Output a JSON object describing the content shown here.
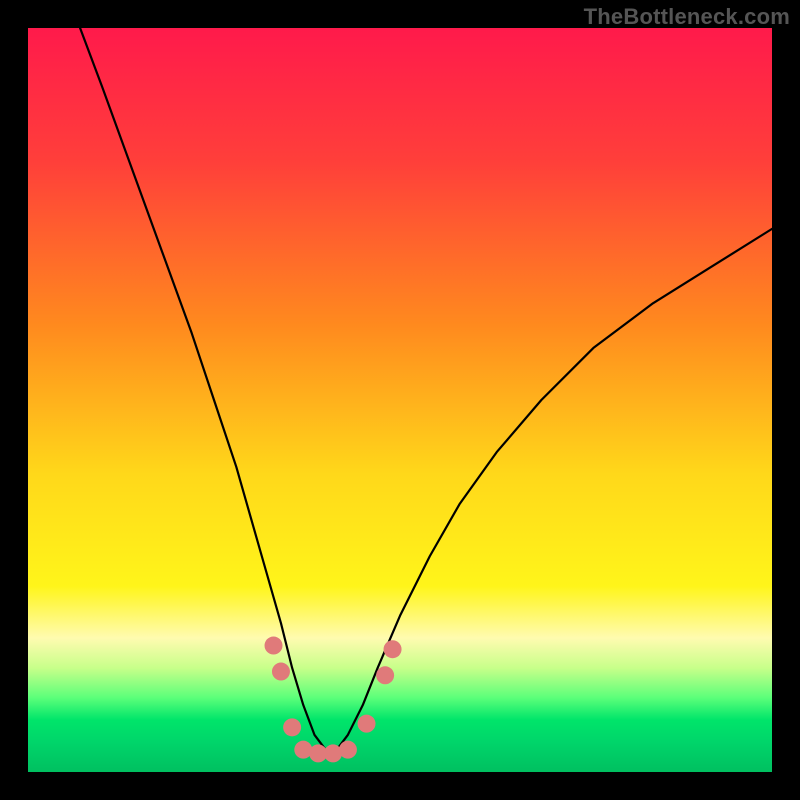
{
  "watermark": "TheBottleneck.com",
  "chart_data": {
    "type": "line",
    "title": "",
    "xlabel": "",
    "ylabel": "",
    "xlim": [
      0,
      100
    ],
    "ylim": [
      0,
      100
    ],
    "gradient_stops": [
      {
        "offset": 0.0,
        "color": "#ff1a4b"
      },
      {
        "offset": 0.18,
        "color": "#ff3f3a"
      },
      {
        "offset": 0.4,
        "color": "#ff8a1e"
      },
      {
        "offset": 0.6,
        "color": "#ffd81a"
      },
      {
        "offset": 0.75,
        "color": "#fff51a"
      },
      {
        "offset": 0.82,
        "color": "#fffbb0"
      },
      {
        "offset": 0.86,
        "color": "#c8ff8a"
      },
      {
        "offset": 0.9,
        "color": "#5cff7a"
      },
      {
        "offset": 0.93,
        "color": "#00e56a"
      },
      {
        "offset": 0.96,
        "color": "#00d56a"
      },
      {
        "offset": 1.0,
        "color": "#00c060"
      }
    ],
    "series": [
      {
        "name": "curve",
        "x": [
          7,
          10,
          14,
          18,
          22,
          25,
          28,
          30,
          32,
          34,
          35.5,
          37,
          38.5,
          40,
          41.5,
          43,
          45,
          47,
          50,
          54,
          58,
          63,
          69,
          76,
          84,
          92,
          100
        ],
        "y": [
          100,
          92,
          81,
          70,
          59,
          50,
          41,
          34,
          27,
          20,
          14,
          9,
          5,
          3,
          3,
          5,
          9,
          14,
          21,
          29,
          36,
          43,
          50,
          57,
          63,
          68,
          73
        ]
      }
    ],
    "markers": {
      "color": "#e07a7a",
      "radius": 9,
      "points": [
        {
          "x": 33.0,
          "y": 17.0
        },
        {
          "x": 34.0,
          "y": 13.5
        },
        {
          "x": 35.5,
          "y": 6.0
        },
        {
          "x": 37.0,
          "y": 3.0
        },
        {
          "x": 39.0,
          "y": 2.5
        },
        {
          "x": 41.0,
          "y": 2.5
        },
        {
          "x": 43.0,
          "y": 3.0
        },
        {
          "x": 45.5,
          "y": 6.5
        },
        {
          "x": 48.0,
          "y": 13.0
        },
        {
          "x": 49.0,
          "y": 16.5
        }
      ]
    }
  }
}
